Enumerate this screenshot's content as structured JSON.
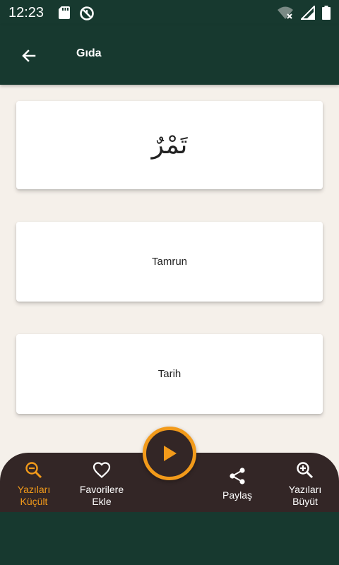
{
  "status_bar": {
    "time": "12:23"
  },
  "app_bar": {
    "title": "Gıda"
  },
  "cards": {
    "arabic": "تَمْرٌ",
    "transliteration": "Tamrun",
    "meaning": "Tarih"
  },
  "bottom_nav": {
    "shrink_text": {
      "line1": "Yazıları",
      "line2": "Küçült"
    },
    "favorites": {
      "line1": "Favorilere",
      "line2": "Ekle"
    },
    "share": {
      "line1": "Paylaş"
    },
    "enlarge_text": {
      "line1": "Yazıları",
      "line2": "Büyüt"
    }
  },
  "colors": {
    "primary_dark_green": "#17392f",
    "background": "#f5f0ea",
    "bottom_bar": "#332626",
    "accent_orange": "#f29a1a"
  },
  "icons": {
    "status_left": [
      "sd-card-icon",
      "sync-off-icon"
    ],
    "status_right": [
      "wifi-off-icon",
      "signal-icon",
      "battery-icon"
    ],
    "app_bar": "arrow-back-icon",
    "nav": [
      "zoom-out-icon",
      "heart-outline-icon",
      "play-icon",
      "share-icon",
      "zoom-in-icon"
    ]
  }
}
